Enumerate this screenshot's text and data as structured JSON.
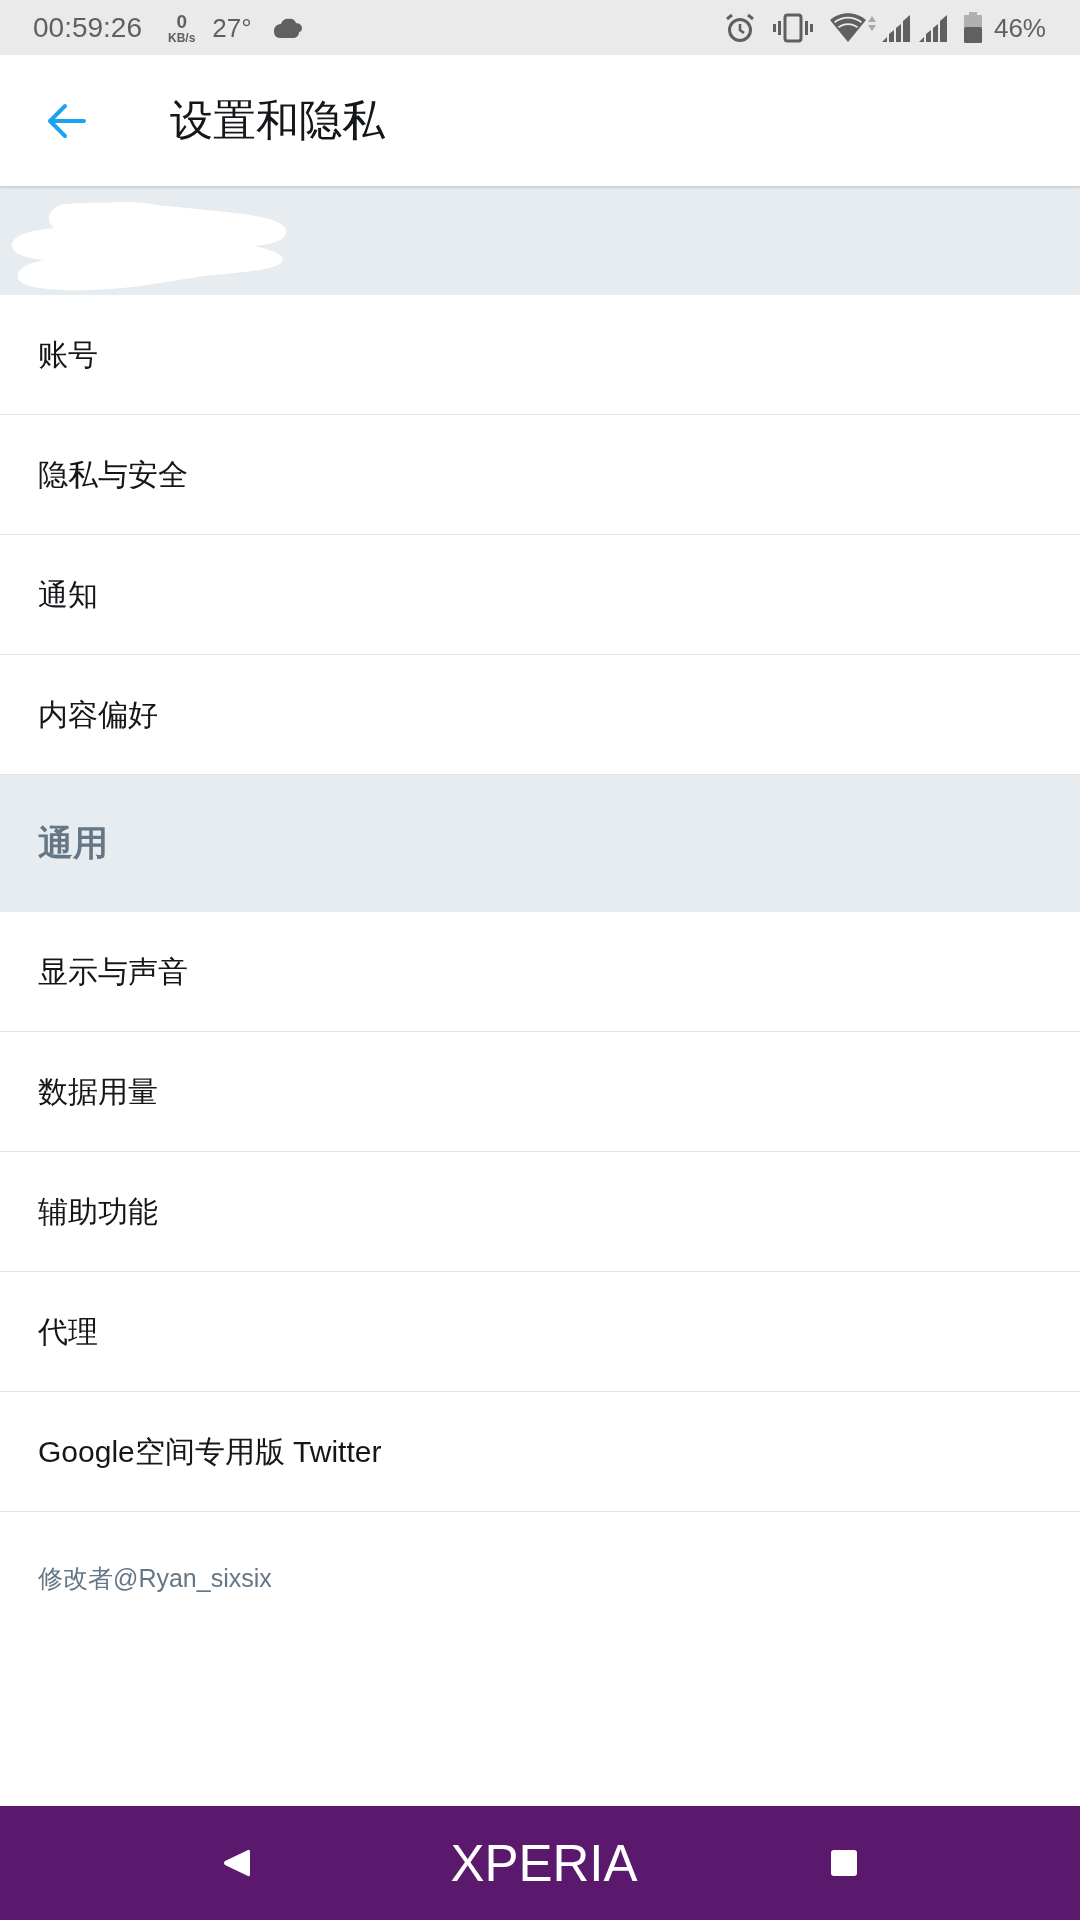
{
  "status_bar": {
    "time": "00:59:26",
    "net_speed_value": "0",
    "net_speed_unit": "KB/s",
    "temperature": "27°",
    "battery_percent": "46%"
  },
  "header": {
    "title": "设置和隐私"
  },
  "account_banner": {
    "redacted": true
  },
  "groups": [
    {
      "items": [
        {
          "label": "账号"
        },
        {
          "label": "隐私与安全"
        },
        {
          "label": "通知"
        },
        {
          "label": "内容偏好"
        }
      ]
    },
    {
      "title": "通用",
      "items": [
        {
          "label": "显示与声音"
        },
        {
          "label": "数据用量"
        },
        {
          "label": "辅助功能"
        },
        {
          "label": "代理"
        },
        {
          "label": "Google空间专用版 Twitter"
        }
      ]
    }
  ],
  "footer_note": "修改者@Ryan_sixsix",
  "nav_bar": {
    "logo": "XPERIA"
  }
}
